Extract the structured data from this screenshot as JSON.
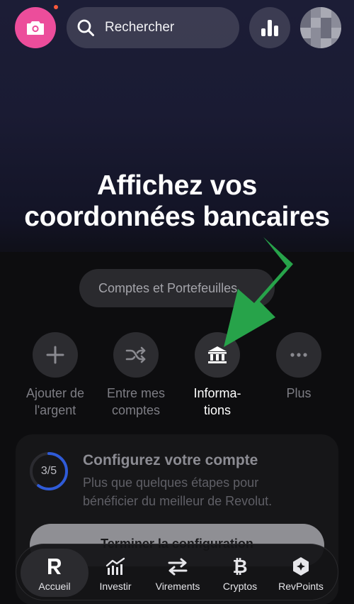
{
  "search": {
    "label": "Rechercher"
  },
  "headline": {
    "line1": "Affichez vos",
    "line2": "coordonnées bancaires"
  },
  "accounts_pill": {
    "label": "Comptes et Portefeuilles"
  },
  "actions": [
    {
      "line1": "Ajouter de",
      "line2": "l'argent",
      "icon": "plus-icon"
    },
    {
      "line1": "Entre mes",
      "line2": "comptes",
      "icon": "shuffle-icon"
    },
    {
      "line1": "Informa-",
      "line2": "tions",
      "icon": "bank-icon"
    },
    {
      "line1": "Plus",
      "line2": "",
      "icon": "more-icon"
    }
  ],
  "setup_card": {
    "progress": "3/5",
    "progress_fraction": 0.6,
    "title": "Configurez votre compte",
    "subtitle": "Plus que quelques étapes pour bénéficier du meilleur de Revolut.",
    "button": "Terminer la configuration"
  },
  "nav": [
    {
      "label": "Accueil",
      "icon": "revolut-logo-icon"
    },
    {
      "label": "Investir",
      "icon": "chart-icon"
    },
    {
      "label": "Virements",
      "icon": "transfer-arrows-icon"
    },
    {
      "label": "Cryptos",
      "icon": "bitcoin-icon"
    },
    {
      "label": "RevPoints",
      "icon": "revpoints-icon"
    }
  ],
  "colors": {
    "camera": "#ec4d9b",
    "notification": "#ff5a3c",
    "annotation_arrow": "#27a34a"
  }
}
